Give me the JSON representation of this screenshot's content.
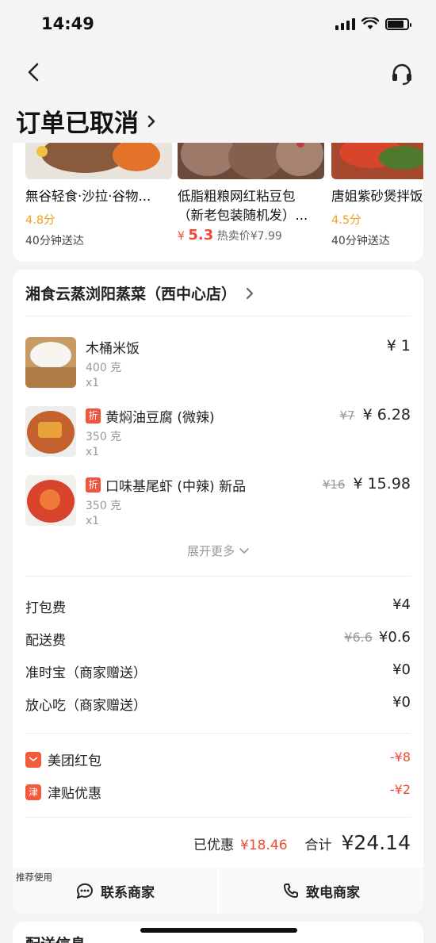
{
  "status_bar": {
    "time": "14:49",
    "battery_level": 0.85
  },
  "header": {
    "title": "订单已取消"
  },
  "recommendations": [
    {
      "name": "無谷轻食·沙拉·谷物...",
      "score": "4.8分",
      "eta": "40分钟送达"
    },
    {
      "name_line1": "低脂粗粮网红粘豆包",
      "name_line2": "（新老包装随机发）...",
      "price_symbol": "¥",
      "price": "5.3",
      "hot_price": "热卖价¥7.99"
    },
    {
      "name": "唐姐紫砂煲拌饭",
      "score": "4.5分",
      "eta": "40分钟送达"
    }
  ],
  "store": {
    "name": "湘食云蒸浏阳蒸菜（西中心店）"
  },
  "dishes": [
    {
      "name": "木桶米饭",
      "weight": "400 克",
      "qty": "x1",
      "price": "¥ 1"
    },
    {
      "tag": "折",
      "name": "黄焖油豆腐 (微辣)",
      "weight": "350 克",
      "qty": "x1",
      "original_price": "¥7",
      "price": "¥ 6.28"
    },
    {
      "tag": "折",
      "name": "口味基尾虾 (中辣) 新品",
      "weight": "350 克",
      "qty": "x1",
      "original_price": "¥16",
      "price": "¥ 15.98"
    }
  ],
  "expand_label": "展开更多",
  "fees": [
    {
      "label": "打包费",
      "value": "¥4"
    },
    {
      "label": "配送费",
      "original": "¥6.6",
      "value": "¥0.6"
    },
    {
      "label": "准时宝（商家赠送）",
      "value": "¥0"
    },
    {
      "label": "放心吃（商家赠送）",
      "value": "¥0"
    }
  ],
  "discounts": [
    {
      "badge": "",
      "label": "美团红包",
      "value": "-¥8"
    },
    {
      "badge": "津",
      "label": "津贴优惠",
      "value": "-¥2"
    }
  ],
  "summary": {
    "saved_label": "已优惠",
    "saved_value": "¥18.46",
    "total_label": "合计",
    "total_value": "¥24.14"
  },
  "actions": {
    "recommend_tag": "推荐使用",
    "contact_label": "联系商家",
    "call_label": "致电商家"
  },
  "delivery": {
    "title": "配送信息"
  },
  "colors": {
    "accent_red": "#ef4a35",
    "score_orange": "#f0a020",
    "background": "#f4f4f4"
  }
}
